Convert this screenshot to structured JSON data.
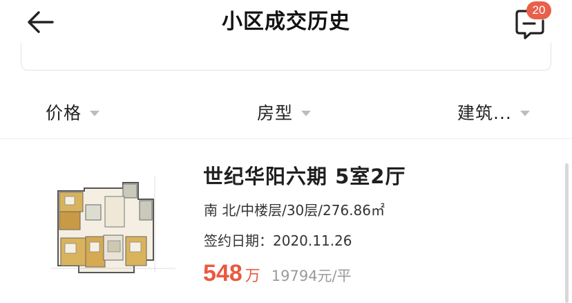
{
  "header": {
    "title": "小区成交历史",
    "message_badge": "20"
  },
  "filters": [
    {
      "label": "价格"
    },
    {
      "label": "房型"
    },
    {
      "label": "建筑..."
    }
  ],
  "listing": {
    "title": "世纪华阳六期 5室2厅",
    "info": "南 北/中楼层/30层/276.86㎡",
    "date": "签约日期：2020.11.26",
    "price": "548",
    "price_unit": "万",
    "unit_price": "19794元/平"
  },
  "colors": {
    "accent": "#e85a3f",
    "badge": "#e9604a",
    "caret": "#bdbdbd",
    "muted": "#9a9a9a"
  },
  "icons": [
    "back-arrow-icon",
    "message-icon",
    "caret-down-icon",
    "floorplan-image"
  ]
}
